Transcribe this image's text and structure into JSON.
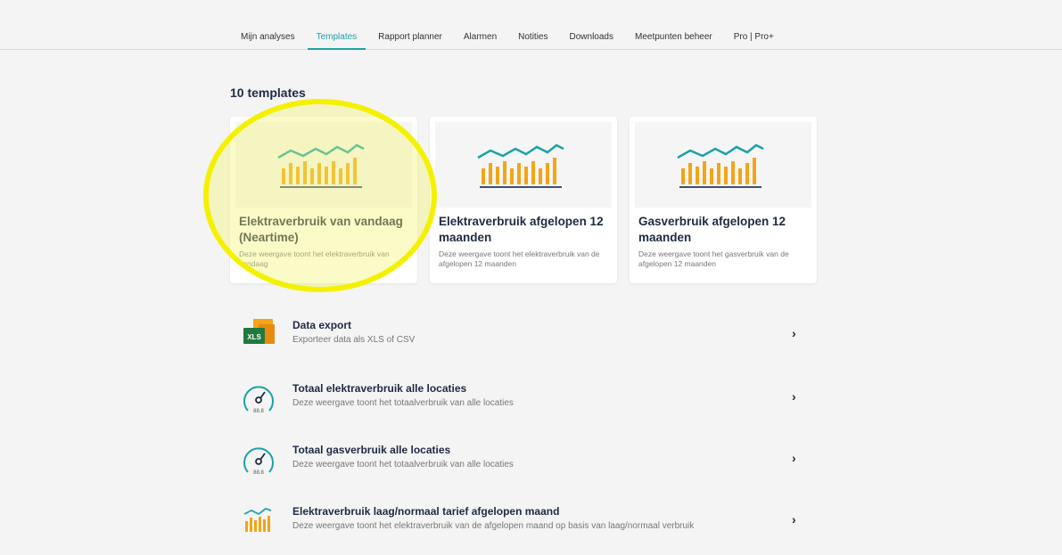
{
  "nav": {
    "tabs": [
      {
        "label": "Mijn analyses"
      },
      {
        "label": "Templates"
      },
      {
        "label": "Rapport planner"
      },
      {
        "label": "Alarmen"
      },
      {
        "label": "Notities"
      },
      {
        "label": "Downloads"
      },
      {
        "label": "Meetpunten beheer"
      },
      {
        "label": "Pro | Pro+"
      }
    ],
    "active_tab": "Templates"
  },
  "main": {
    "heading": "10 templates",
    "cards": [
      {
        "title": "Elektraverbruik van vandaag (Neartime)",
        "desc": "Deze weergave toont het elektraverbruik van vandaag"
      },
      {
        "title": "Elektraverbruik afgelopen 12 maanden",
        "desc": "Deze weergave toont het elektraverbruik van de afgelopen 12 maanden"
      },
      {
        "title": "Gasverbruik afgelopen 12 maanden",
        "desc": "Deze weergave toont het gasverbruik van de afgelopen 12 maanden"
      }
    ],
    "list": [
      {
        "title": "Data export",
        "desc": "Exporteer data als XLS of CSV",
        "icon": "xls-icon",
        "icon_text": "XLS"
      },
      {
        "title": "Totaal elektraverbruik alle locaties",
        "desc": "Deze weergave toont het totaalverbruik van alle locaties",
        "icon": "gauge-icon",
        "icon_text": "88.8"
      },
      {
        "title": "Totaal gasverbruik alle locaties",
        "desc": "Deze weergave toont het totaalverbruik van alle locaties",
        "icon": "gauge-icon",
        "icon_text": "88.8"
      },
      {
        "title": "Elektraverbruik laag/normaal tarief afgelopen maand",
        "desc": "Deze weergave toont het elektraverbruik van de afgelopen maand op basis van laag/normaal verbruik",
        "icon": "bar-chart-icon"
      }
    ],
    "chevron": "›"
  },
  "colors": {
    "accent": "#1aa3a8",
    "bar": "#f2a516",
    "highlight": "#f4f100",
    "text_dark": "#1f2a44"
  }
}
